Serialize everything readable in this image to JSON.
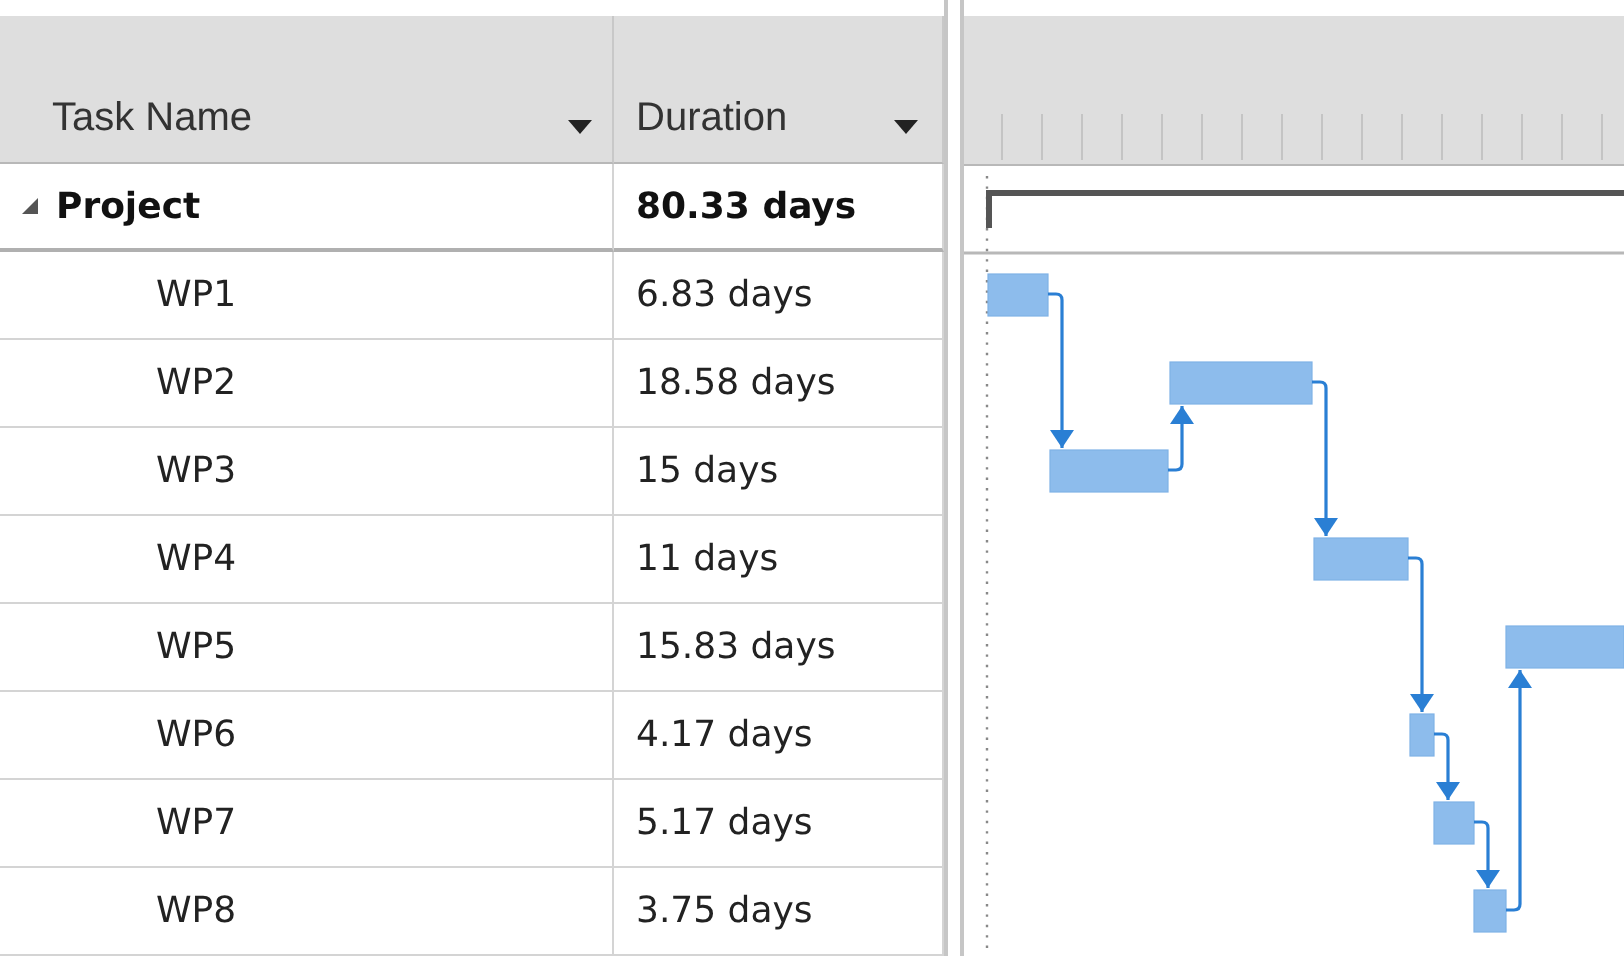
{
  "table": {
    "columns": [
      {
        "label": "Task Name"
      },
      {
        "label": "Duration"
      }
    ],
    "rows": [
      {
        "name": "Project",
        "duration": "80.33 days",
        "expanded": true,
        "children": [
          {
            "name": "WP1",
            "duration": "6.83 days"
          },
          {
            "name": "WP2",
            "duration": "18.58 days"
          },
          {
            "name": "WP3",
            "duration": "15 days"
          },
          {
            "name": "WP4",
            "duration": "11 days"
          },
          {
            "name": "WP5",
            "duration": "15.83 days"
          },
          {
            "name": "WP6",
            "duration": "4.17 days"
          },
          {
            "name": "WP7",
            "duration": "5.17 days"
          },
          {
            "name": "WP8",
            "duration": "3.75 days"
          }
        ]
      }
    ]
  }
}
